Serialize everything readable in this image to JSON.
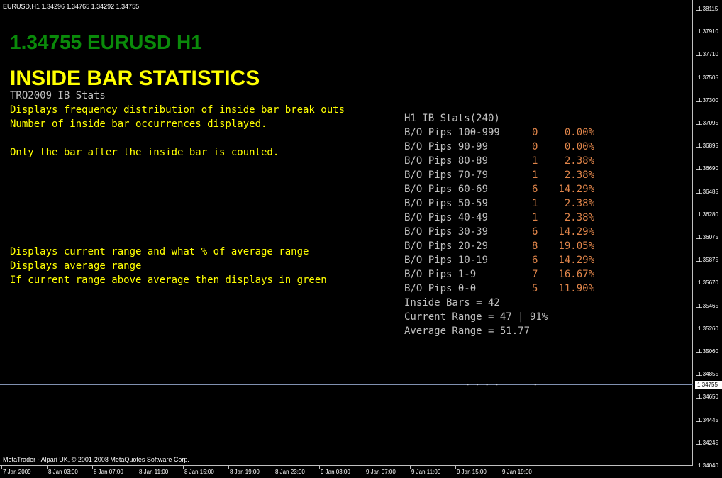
{
  "window": {
    "header": "EURUSD,H1  1.34296 1.34765 1.34292 1.34755",
    "copyright": "MetaTrader - Alpari UK, © 2001-2008 MetaQuotes Software Corp."
  },
  "titles": {
    "price": "1.34755 EURUSD H1",
    "stats": "INSIDE BAR STATISTICS"
  },
  "description": {
    "name": "TRO2009_IB_Stats",
    "lines": [
      "Displays frequency distribution of inside bar break outs",
      "Number of inside bar occurrences displayed.",
      "",
      "Only the bar after the inside bar is counted."
    ],
    "lines2": [
      "Displays current range and what % of average range",
      "Displays average range",
      "If current range above average then displays in green"
    ]
  },
  "stats": {
    "heading": "H1 IB Stats(240)",
    "rows": [
      {
        "label": "B/O Pips 100-999",
        "count": "0",
        "pct": "0.00%"
      },
      {
        "label": "B/O Pips 90-99",
        "count": "0",
        "pct": "0.00%"
      },
      {
        "label": "B/O Pips 80-89",
        "count": "1",
        "pct": "2.38%"
      },
      {
        "label": "B/O Pips 70-79",
        "count": "1",
        "pct": "2.38%"
      },
      {
        "label": "B/O Pips 60-69",
        "count": "6",
        "pct": "14.29%"
      },
      {
        "label": "B/O Pips 50-59",
        "count": "1",
        "pct": "2.38%"
      },
      {
        "label": "B/O Pips 40-49",
        "count": "1",
        "pct": "2.38%"
      },
      {
        "label": "B/O Pips 30-39",
        "count": "6",
        "pct": "14.29%"
      },
      {
        "label": "B/O Pips 20-29",
        "count": "8",
        "pct": "19.05%"
      },
      {
        "label": "B/O Pips 10-19",
        "count": "6",
        "pct": "14.29%"
      },
      {
        "label": "B/O Pips 1-9",
        "count": "7",
        "pct": "16.67%"
      },
      {
        "label": "B/O Pips 0-0",
        "count": "5",
        "pct": "11.90%"
      }
    ],
    "inside_bars": "Inside Bars = 42",
    "current_range": "Current Range = 47 | 91%",
    "average_range": "Average Range = 51.77"
  },
  "price_axis": {
    "ticks": [
      "1.38115",
      "1.37910",
      "1.37710",
      "1.37505",
      "1.37300",
      "1.37095",
      "1.36895",
      "1.36690",
      "1.36485",
      "1.36280",
      "1.36075",
      "1.35875",
      "1.35670",
      "1.35465",
      "1.35260",
      "1.35060",
      "1.34855",
      "1.34650",
      "1.34445",
      "1.34245",
      "1.34040"
    ],
    "current": "1.34755"
  },
  "time_axis": {
    "ticks": [
      "7 Jan 2009",
      "8 Jan 03:00",
      "8 Jan 07:00",
      "8 Jan 11:00",
      "8 Jan 15:00",
      "8 Jan 19:00",
      "8 Jan 23:00",
      "9 Jan 03:00",
      "9 Jan 07:00",
      "9 Jan 11:00",
      "9 Jan 15:00",
      "9 Jan 19:00"
    ]
  },
  "colors": {
    "price_title": "#0a8a0a",
    "stats_title": "#ffff00",
    "stat_values": "#e0854a"
  }
}
